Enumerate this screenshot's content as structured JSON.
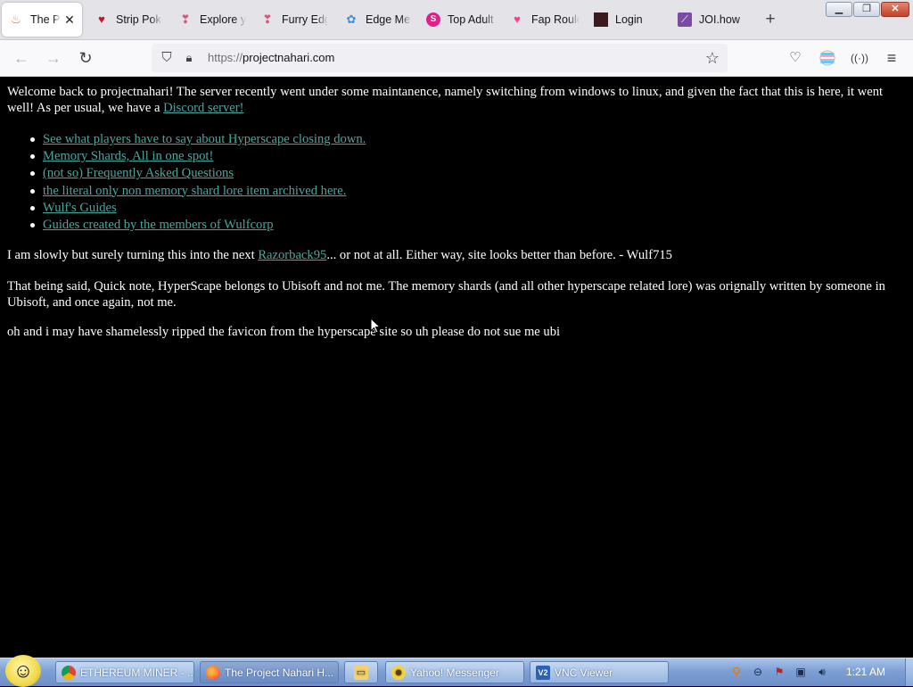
{
  "browser": {
    "tabs": [
      {
        "title": "The Project Nahari Hub",
        "icon": "flame-tab-icon",
        "active": true
      },
      {
        "title": "Strip Poker",
        "icon": "heart-tab-icon",
        "active": false
      },
      {
        "title": "Explore your",
        "icon": "heart-box-tab-icon",
        "active": false
      },
      {
        "title": "Furry Edge",
        "icon": "heart-box-tab-icon",
        "active": false
      },
      {
        "title": "Edge Me",
        "icon": "blue-dots-tab-icon",
        "active": false
      },
      {
        "title": "Top Adult",
        "icon": "s-circle-tab-icon",
        "active": false
      },
      {
        "title": "Fap Roulette",
        "icon": "pink-heart-tab-icon",
        "active": false
      },
      {
        "title": "Login",
        "icon": "dark-square-tab-icon",
        "active": false
      },
      {
        "title": "JOI.how",
        "icon": "joi-tab-icon",
        "active": false
      }
    ],
    "url": {
      "protocol": "https://",
      "domain": "projectnahari.com"
    }
  },
  "page": {
    "intro_text": "Welcome back to projectnahari! The server recently went under some maintanence, namely switching from windows to linux, and given the fact that this is here, it went well! As per usual, we have a ",
    "discord_link": "Discord server!",
    "links": [
      "See what players have to say about Hyperscape closing down.",
      "Memory Shards, All in one spot!",
      "(not so) Frequently Asked Questions",
      "the literal only non memory shard lore item archived here.",
      "Wulf's Guides",
      "Guides created by the members of Wulfcorp"
    ],
    "razorback_before": "I am slowly but surely turning this into the next ",
    "razorback_link": "Razorback95",
    "razorback_after": "... or not at all. Either way, site looks better than before. - Wulf715",
    "note_text": "That being said, Quick note, HyperScape belongs to Ubisoft and not me. The memory shards (and all other hyperscape related lore) was orignally written by someone in Ubisoft, and once again, not me.",
    "favicon_text": "oh and i may have shamelessly ripped the favicon from the hyperscape site so uh please do not sue me ubi"
  },
  "taskbar": {
    "tasks": [
      {
        "label": "ETHEREUM MINER - ...",
        "icon": "chrome-icon"
      },
      {
        "label": "The Project Nahari H...",
        "icon": "firefox-icon"
      },
      {
        "label": "",
        "icon": "folder-icon"
      },
      {
        "label": "Yahoo! Messenger",
        "icon": "yahoo-smiley-icon"
      },
      {
        "label": "VNC Viewer",
        "icon": "vnc-icon"
      }
    ],
    "clock": "1:21 AM"
  },
  "colors": {
    "page_background": "#000000",
    "page_text": "#ffffff",
    "link": "#4aa79e",
    "taskbar": "#7d9fd4"
  }
}
